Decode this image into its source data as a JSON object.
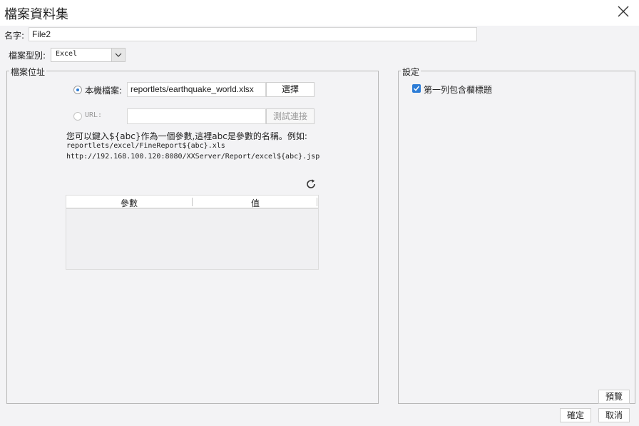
{
  "dialog": {
    "title": "檔案資料集"
  },
  "name": {
    "label": "名字:",
    "value": "File2"
  },
  "file_type": {
    "label": "檔案型別:",
    "selected": "Excel"
  },
  "location": {
    "legend": "檔案位址",
    "local": {
      "label": "本機檔案:",
      "value": "reportlets/earthquake_world.xlsx",
      "button": "選擇"
    },
    "url": {
      "label": "URL:",
      "value": "",
      "button": "測試連接"
    },
    "hint_line1": "您可以鍵入${abc}作為一個參數,這裡abc是參數的名稱。例如:",
    "hint_line2": "reportlets/excel/FineReport${abc}.xls",
    "hint_line3": "http://192.168.100.120:8080/XXServer/Report/excel${abc}.jsp",
    "params_table": {
      "columns": [
        "參數",
        "值"
      ],
      "rows": []
    }
  },
  "settings": {
    "legend": "設定",
    "first_row_header": {
      "label": "第一列包含欄標題",
      "checked": true
    }
  },
  "footer": {
    "preview": "預覽",
    "ok": "確定",
    "cancel": "取消"
  }
}
